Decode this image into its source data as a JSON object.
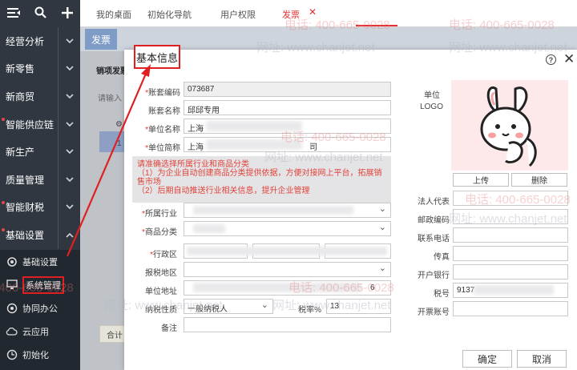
{
  "sidebar": {
    "items": [
      {
        "label": "经营分析",
        "dot": false
      },
      {
        "label": "新零售",
        "dot": false
      },
      {
        "label": "新商贸",
        "dot": false
      },
      {
        "label": "智能供应链",
        "dot": true
      },
      {
        "label": "新生产",
        "dot": false
      },
      {
        "label": "质量管理",
        "dot": false
      },
      {
        "label": "智能财税",
        "dot": true
      },
      {
        "label": "基础设置",
        "dot": true
      }
    ],
    "sub_items": [
      {
        "label": "基础设置",
        "icon": "settings-icon"
      },
      {
        "label": "系统管理",
        "icon": "monitor-icon"
      },
      {
        "label": "协同办公",
        "icon": "collab-icon"
      },
      {
        "label": "云应用",
        "icon": "cloud-icon"
      },
      {
        "label": "初始化",
        "icon": "init-icon"
      }
    ]
  },
  "tabs": [
    {
      "label": "我的桌面"
    },
    {
      "label": "初始化导航"
    },
    {
      "label": "用户权限"
    },
    {
      "label": "发票",
      "active": true
    }
  ],
  "page": {
    "title": "发票",
    "subtitle": "销项发票",
    "input_hint": "请输入",
    "row_no": "1",
    "bottom_btn": "合计"
  },
  "dialog": {
    "title": "基本信息",
    "fields": {
      "account_code_label": "账套编码",
      "account_code_value": "073687",
      "account_name_label": "账套名称",
      "account_name_value": "邱邱专用",
      "unit_name_label": "单位名称",
      "unit_name_value": "上海",
      "unit_short_label": "单位简称",
      "unit_short_value": "上海",
      "unit_short_tail": "司",
      "industry_label": "所属行业",
      "goods_class_label": "商品分类",
      "region_label": "行政区",
      "tax_area_label": "报税地区",
      "address_label": "单位地址",
      "address_tail": "6",
      "taxpayer_label": "纳税性质",
      "taxpayer_value": "一般纳税人",
      "tax_rate_label": "税率%",
      "tax_rate_value": "13",
      "remark_label": "备注"
    },
    "notice": {
      "line1": "请准确选择所属行业和商品分类",
      "line2": "（1）为企业自动创建商品分类提供依据，方便对接网上平台，拓展销售市场",
      "line3": "（2）后期自动推送行业相关信息，提升企业管理"
    },
    "right": {
      "logo_label_1": "单位",
      "logo_label_2": "LOGO",
      "upload_btn": "上传",
      "delete_btn": "删除",
      "legal_rep_label": "法人代表",
      "postcode_label": "邮政编码",
      "phone_label": "联系电话",
      "fax_label": "传真",
      "bank_label": "开户银行",
      "tax_no_label": "税号",
      "tax_no_value": "9137",
      "invoice_acct_label": "开票账号"
    },
    "ok_btn": "确定",
    "cancel_btn": "取消"
  },
  "watermark": {
    "phone": "电话: 400-665-0028",
    "site": "网址: www.chanjet.net"
  },
  "colors": {
    "sidebar": "#303741",
    "accent": "#e83030",
    "dialog_bg": "#ffffff"
  }
}
